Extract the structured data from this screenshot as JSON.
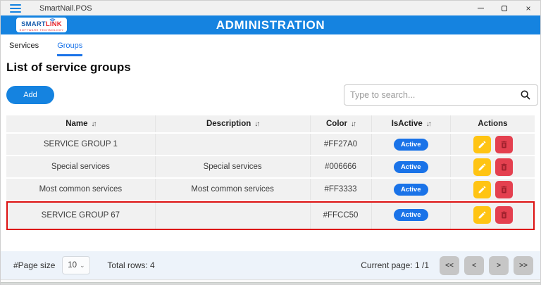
{
  "window": {
    "title": "SmartNail.POS",
    "close_glyph": "×"
  },
  "header": {
    "title": "ADMINISTRATION",
    "logo": {
      "part1": "SMART",
      "part2": "LINK",
      "subtitle": "SOFTWARE TECHNOLOGY"
    }
  },
  "tabs": [
    {
      "label": "Services",
      "active": false
    },
    {
      "label": "Groups",
      "active": true
    }
  ],
  "page": {
    "heading": "List of service groups",
    "add_button_label": "Add"
  },
  "search": {
    "placeholder": "Type to search..."
  },
  "icons": {
    "sort": "↓↑",
    "chevron_down": "⌄"
  },
  "table": {
    "columns": [
      {
        "label": "Name",
        "sortable": true
      },
      {
        "label": "Description",
        "sortable": true
      },
      {
        "label": "Color",
        "sortable": true
      },
      {
        "label": "IsActive",
        "sortable": true
      },
      {
        "label": "Actions",
        "sortable": false
      }
    ],
    "rows": [
      {
        "name": "SERVICE GROUP 1",
        "description": "",
        "color": "#FF27A0",
        "is_active": "Active",
        "highlighted": false
      },
      {
        "name": "Special services",
        "description": "Special services",
        "color": "#006666",
        "is_active": "Active",
        "highlighted": false
      },
      {
        "name": "Most common services",
        "description": "Most common services",
        "color": "#FF3333",
        "is_active": "Active",
        "highlighted": false
      },
      {
        "name": "SERVICE GROUP 67",
        "description": "",
        "color": "#FFCC50",
        "is_active": "Active",
        "highlighted": true
      }
    ]
  },
  "footer": {
    "page_size_label": "#Page size",
    "page_size_value": "10",
    "total_rows_label": "Total rows: 4",
    "current_page_label": "Current page: 1 /1",
    "pagination": [
      "<<",
      "<",
      ">",
      ">>"
    ]
  },
  "colors": {
    "header_bar": "#1583e0",
    "active_tab": "#1a73e8",
    "badge": "#1a73e8",
    "edit_button": "#ffc413",
    "delete_button": "#e4404f",
    "highlight_border": "#dd1111",
    "footer_bg": "#edf3fa"
  }
}
